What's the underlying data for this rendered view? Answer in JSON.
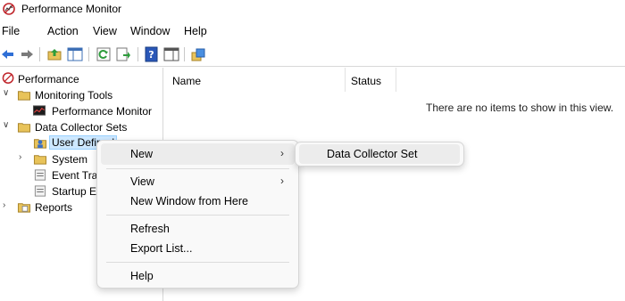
{
  "window": {
    "title": "Performance Monitor"
  },
  "menubar": [
    "File",
    "Action",
    "View",
    "Window",
    "Help"
  ],
  "toolbar": {
    "icons": [
      "back-arrow-icon",
      "forward-arrow-icon",
      "up-folder-icon",
      "show-hide-tree-icon",
      "refresh-icon",
      "export-list-icon",
      "help-icon",
      "show-hide-action-pane-icon",
      "properties-icon"
    ]
  },
  "tree": {
    "performance": "Performance",
    "monitoring_tools": "Monitoring Tools",
    "performance_monitor": "Performance Monitor",
    "data_collector_sets": "Data Collector Sets",
    "user_defined": "User Defined",
    "system": "System",
    "event_trace": "Event Trac",
    "startup_event": "Startup Ev",
    "reports": "Reports"
  },
  "list": {
    "columns": [
      "Name",
      "Status"
    ],
    "empty_message": "There are no items to show in this view."
  },
  "context_menu": {
    "new": "New",
    "view": "View",
    "new_window": "New Window from Here",
    "refresh": "Refresh",
    "export_list": "Export List...",
    "help": "Help",
    "submenu_arrow": "›"
  },
  "submenu": {
    "data_collector_set": "Data Collector Set"
  },
  "colors": {
    "selection": "#cde8ff",
    "menu_bg": "#f9f9f9",
    "highlight": "#ececec"
  }
}
